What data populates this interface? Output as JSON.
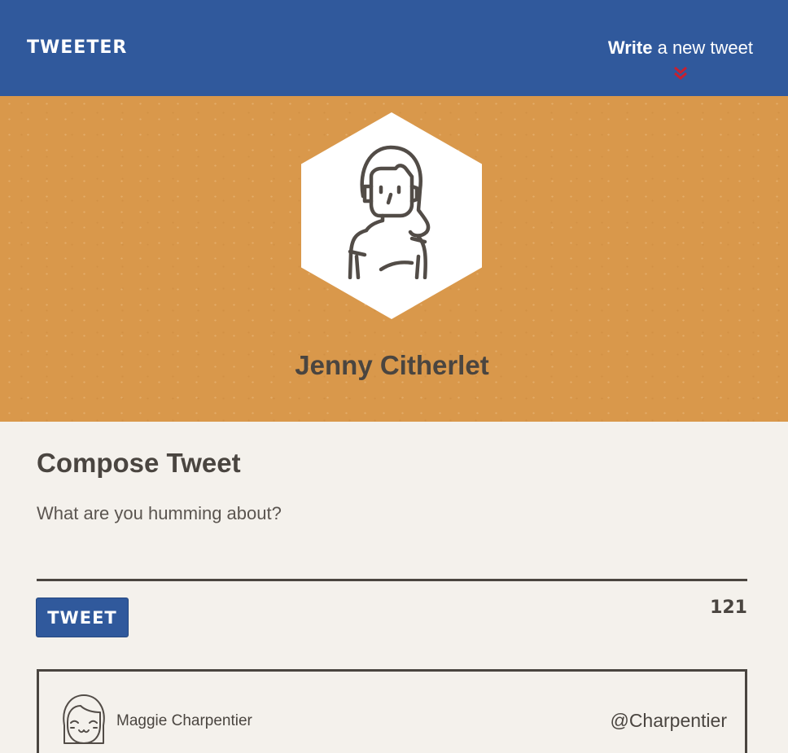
{
  "nav": {
    "brand": "TWEETER",
    "compose_bold": "Write",
    "compose_rest": " a new tweet",
    "chevron_icon": "chevron-double-down-icon",
    "accent_color": "#c8202f"
  },
  "profile": {
    "name": "Jenny Citherlet",
    "avatar_icon": "woman-avatar-icon",
    "background_color": "#d9984b"
  },
  "compose": {
    "title": "Compose Tweet",
    "placeholder": "What are you humming about?",
    "value": "",
    "button_label": "TWEET",
    "counter": "121"
  },
  "tweets": [
    {
      "author": "Maggie Charpentier",
      "handle": "@Charpentier",
      "avatar_icon": "girl-avatar-icon"
    }
  ],
  "colors": {
    "nav_blue": "#30599c",
    "text_dark": "#4a4540",
    "page_bg": "#f4f1ec"
  }
}
